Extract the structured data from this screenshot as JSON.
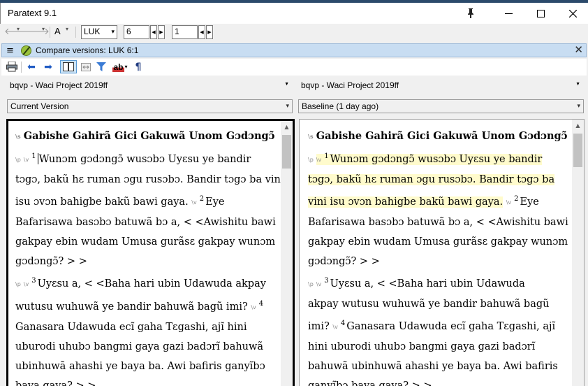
{
  "window": {
    "title": "Paratext 9.1",
    "controls": {
      "pin": "📌",
      "minimize": "—",
      "maximize": "☐",
      "close": "✕"
    }
  },
  "navbar": {
    "font_label": "A",
    "book": "LUK",
    "chapter": "6",
    "verse": "1"
  },
  "panel": {
    "title": "Compare versions: LUK 6:1",
    "close": "✕"
  },
  "toolbar": {
    "icons": [
      "printer-icon",
      "arrow-left-icon",
      "arrow-right-icon",
      "side-by-side-icon",
      "collapse-icon",
      "filter-icon",
      "spell-check-icon",
      "pilcrow-icon"
    ],
    "spell_label": "ab"
  },
  "left": {
    "project": "bqvp - Waci Project 2019ff",
    "version": "Current Version"
  },
  "right": {
    "project": "bqvp - Waci Project 2019ff",
    "version": "Baseline (1 day ago)"
  },
  "markers": {
    "section": "\\s",
    "paragraph": "\\p",
    "verse": "\\v"
  },
  "text": {
    "heading": "Gabishe Gahirã Gici Gakuwã Unom Gɔdɔngɔ̃",
    "left_lines": [
      {
        "v": "1",
        "text": "Wunɔm gɔdɔngɔ̃ wusɔbɔ Uyɛsu ye bandir"
      },
      {
        "text": "tɔgɔ, bakũ hɛ ruman ɔgu rusɔbɔ. Bandir tɔgɔ ba vini"
      },
      {
        "text": "isu ɔvɔn bahigbe bakũ bawi gaya.",
        "v2": "2",
        "tail": "Eye"
      },
      {
        "text": "Bafarisawa basɔbɔ batuwã bɔ a, < <Awishitu bawi"
      },
      {
        "text": "gakpay ebin wudam Umusa gurãsɛ gakpay wunɔm"
      },
      {
        "text": "gɔdɔngɔ̃? > >"
      },
      {
        "v": "3",
        "text": "Uyɛsu a, < <Baha hari ubin Udawuda akpay"
      },
      {
        "text": "wutusu wuhuwã ye bandir bahuwã bagũ imi?",
        "v2": "4"
      },
      {
        "text": "Ganasara Udawuda ecĩ gaha Tɛgashi, ajĩ hini"
      },
      {
        "text": "uburodi uhubɔ bangmi gaya gazi badɔrĩ bahuwã"
      },
      {
        "text": "ubinhuwã ahashi ye baya ba. Awi bafiris ganyĩbɔ"
      },
      {
        "text": "baya gaya? > >"
      }
    ],
    "right_lines": [
      {
        "v": "1",
        "text": "Wunɔm gɔdɔngɔ̃ wusɔbɔ Uyɛsu ye bandir"
      },
      {
        "text": "tɔgɔ, bakũ hɛ ruman ɔgu rusɔbɔ. Bandir tɔgɔ ba"
      },
      {
        "text": "vini isu ɔvɔn bahigbe bakũ bawi gaya.",
        "v2": "2",
        "tail": "Eye"
      },
      {
        "text": "Bafarisawa basɔbɔ batuwã bɔ a, < <Awishitu bawi"
      },
      {
        "text": "gakpay ebin wudam Umusa gurãsɛ gakpay wunɔm"
      },
      {
        "text": "gɔdɔngɔ̃? > >"
      },
      {
        "v": "3",
        "text": "Uyɛsu a, < <Baha hari ubin Udawuda"
      },
      {
        "text": "akpay wutusu wuhuwã ye bandir bahuwã bagũ"
      },
      {
        "text": "imi?",
        "v2": "4",
        "tail": "Ganasara Udawuda ecĩ gaha Tɛgashi, ajĩ"
      },
      {
        "text": "hini uburodi uhubɔ bangmi gaya gazi badɔrĩ"
      },
      {
        "text": "bahuwã ubinhuwã ahashi ye baya ba. Awi bafiris"
      },
      {
        "text": "ganyĩbɔ baya gaya? > >"
      }
    ]
  },
  "colors": {
    "panel_header": "#c8ddf2",
    "highlight": "#fffbcc",
    "marker": "#8a8a8a"
  }
}
